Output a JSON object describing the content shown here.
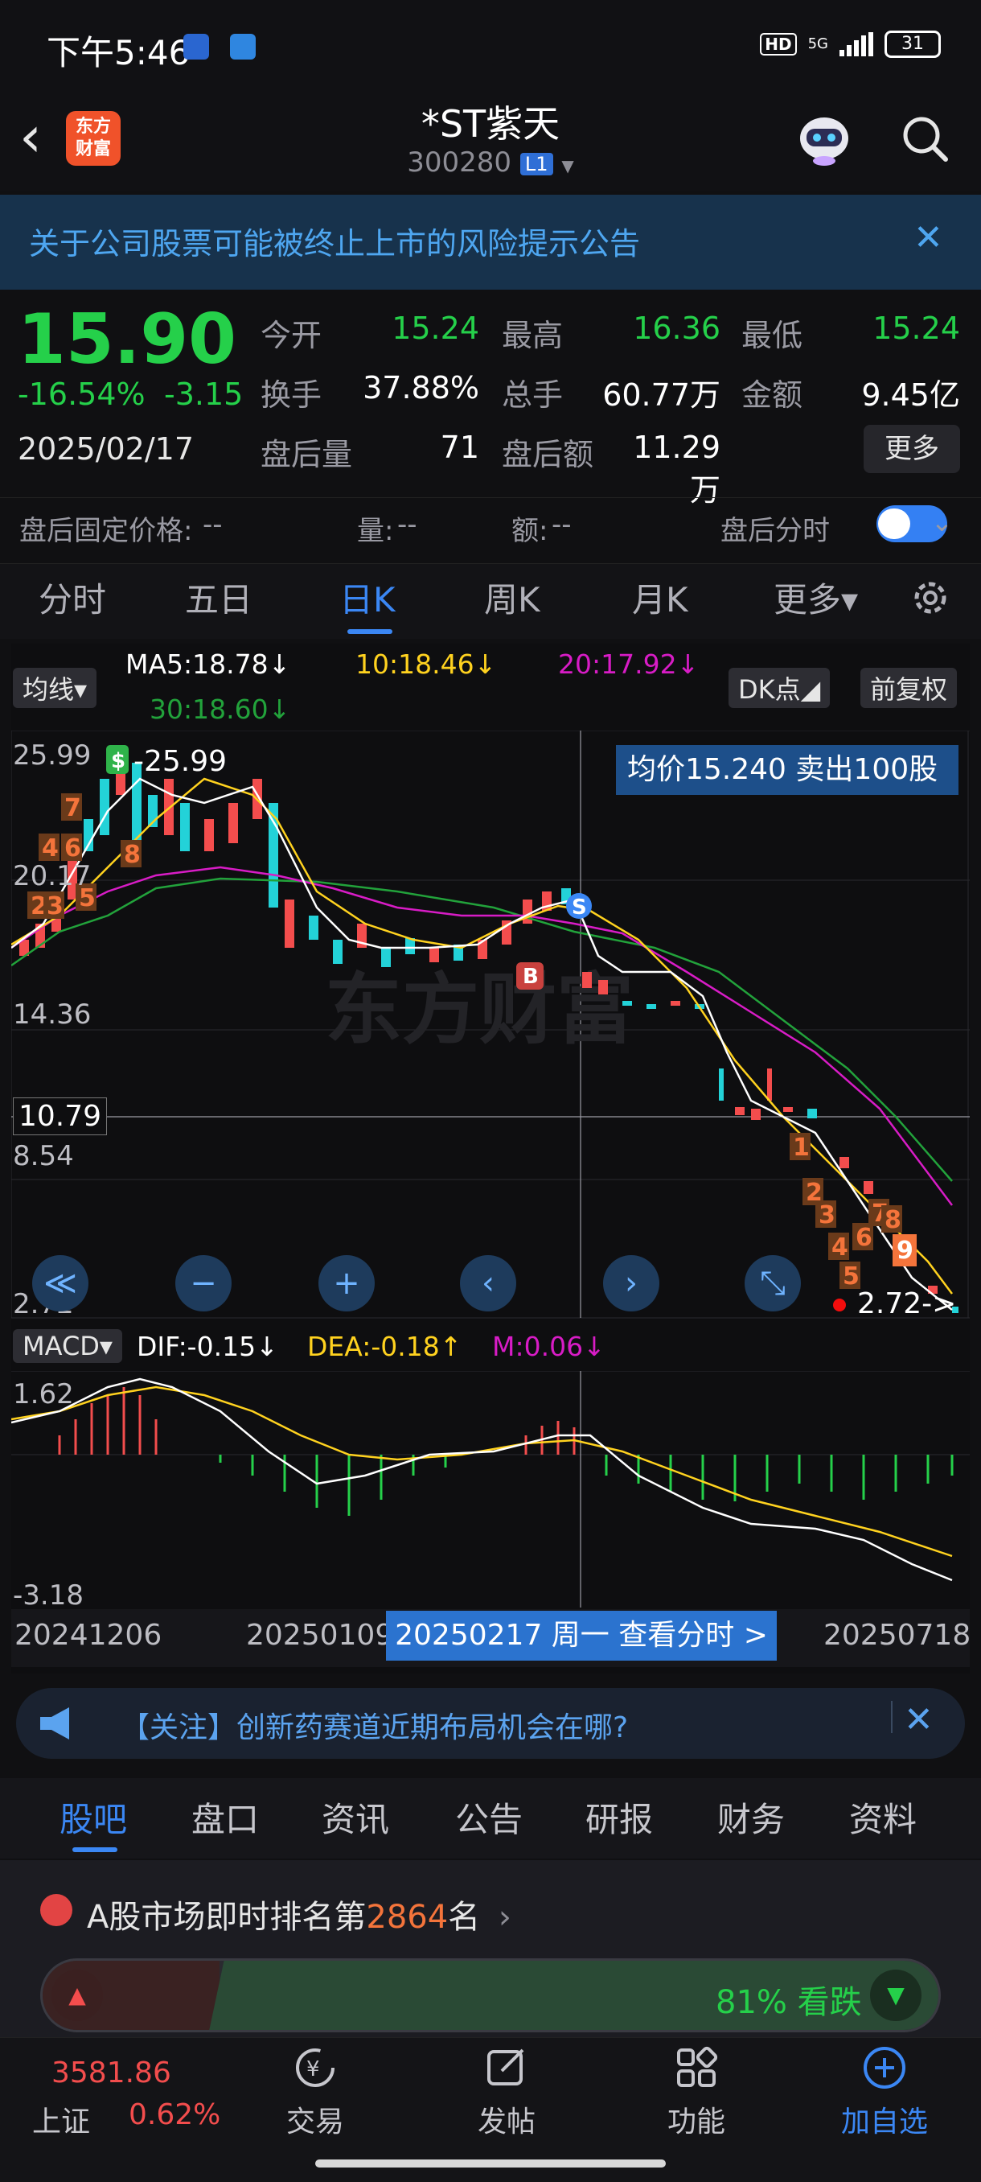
{
  "status_bar": {
    "time": "下午5:46",
    "hd": "HD",
    "network": "5G",
    "battery": "31"
  },
  "header": {
    "back": "‹",
    "logo": "东方\n财富",
    "title": "*ST紫天",
    "code": "300280",
    "level": "L1",
    "level_arrow": "▼"
  },
  "notice": {
    "text": "关于公司股票可能被终止上市的风险提示公告",
    "close": "✕"
  },
  "quote": {
    "price": "15.90",
    "change_pct": "-16.54%",
    "change_amt": "-3.15",
    "date": "2025/02/17",
    "fields": [
      {
        "label": "今开",
        "value": "15.24"
      },
      {
        "label": "最高",
        "value": "16.36"
      },
      {
        "label": "最低",
        "value": "15.24"
      },
      {
        "label": "换手",
        "value": "37.88%"
      },
      {
        "label": "总手",
        "value": "60.77万"
      },
      {
        "label": "金额",
        "value": "9.45亿"
      },
      {
        "label": "盘后量",
        "value": "71"
      },
      {
        "label": "盘后额",
        "value": "11.29万"
      }
    ],
    "more": "更多"
  },
  "after_hours": {
    "fixed_price_label": "盘后固定价格:",
    "fixed_price": "--",
    "vol_label": "量:",
    "vol": "--",
    "amt_label": "额:",
    "amt": "--",
    "intraday_label": "盘后分时",
    "toggle_on": true
  },
  "period_tabs": [
    "分时",
    "五日",
    "日K",
    "周K",
    "月K",
    "更多▾"
  ],
  "chart_toolbar": {
    "ma_select": "均线▾",
    "ma5": "MA5:18.78↓",
    "ma10": "10:18.46↓",
    "ma20": "20:17.92↓",
    "ma30": "30:18.60↓",
    "dk": "DK点◢",
    "adjust": "前复权",
    "avg_box": "均价15.240  卖出100股"
  },
  "kline": {
    "y_labels": [
      "25.99",
      "20.17",
      "14.36",
      "8.54",
      "2.72"
    ],
    "high_mark": "-25.99",
    "low_mark": "2.72->",
    "crosshair_price": "10.79",
    "buy_mark": "B",
    "sell_mark": "S",
    "dollar_mark": "$",
    "td_labels": [
      "7",
      "4",
      "6",
      "2",
      "3",
      "5",
      "8",
      "1",
      "2",
      "3",
      "4",
      "5",
      "6",
      "7",
      "8",
      "9"
    ],
    "watermark": "东方财富",
    "controls": [
      "≪",
      "−",
      "+",
      "‹",
      "›",
      "⤡"
    ]
  },
  "macd": {
    "select": "MACD▾",
    "dif": "DIF:-0.15↓",
    "dea": "DEA:-0.18↑",
    "m": "M:0.06↓",
    "y_top": "1.62",
    "y_bottom": "-3.18"
  },
  "dates": {
    "start": "20241206",
    "mid": "20250109",
    "end": "20250718",
    "pill": "20250217 周一  查看分时 >"
  },
  "ad": {
    "text": "【关注】创新药赛道近期布局机会在哪?",
    "close": "✕"
  },
  "info_tabs": [
    "股吧",
    "盘口",
    "资讯",
    "公告",
    "研报",
    "财务",
    "资料"
  ],
  "ranking": {
    "prefix": "A股市场即时排名第",
    "rank": "2864",
    "suffix": "名",
    "arrow": "›"
  },
  "sentiment": {
    "text": "81% 看跌",
    "bearish_pct": 81,
    "up": "▲",
    "down": "▼"
  },
  "bottom_nav": {
    "index_value": "3581.86",
    "index_name": "上证",
    "index_pct": "0.62%",
    "items": [
      {
        "label": "交易",
        "icon": "trade-icon"
      },
      {
        "label": "发帖",
        "icon": "post-icon"
      },
      {
        "label": "功能",
        "icon": "apps-icon"
      },
      {
        "label": "加自选",
        "icon": "add-icon"
      }
    ]
  },
  "colors": {
    "up": "#f34d4d",
    "down": "#25d04a",
    "accent": "#3b87f4",
    "ma5": "#ffffff",
    "ma10": "#ffd21f",
    "ma20": "#d81cc6",
    "ma30": "#22a23b"
  }
}
